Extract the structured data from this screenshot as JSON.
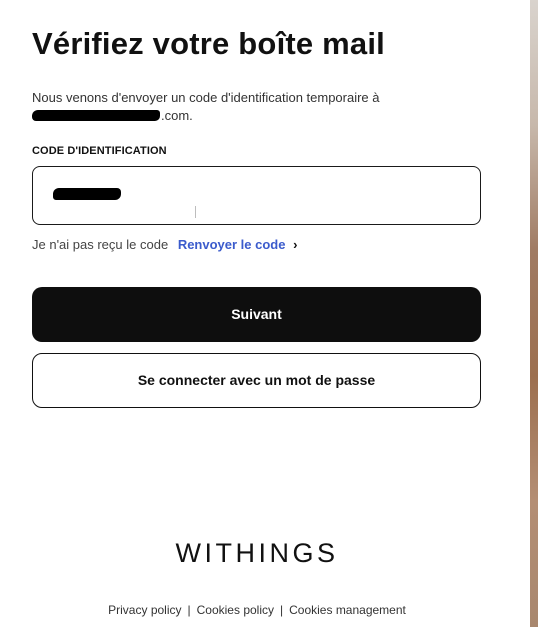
{
  "title": "Vérifiez votre boîte mail",
  "intro": {
    "line1": "Nous venons d'envoyer un code d'identification temporaire à",
    "email_suffix": ".com."
  },
  "code_field": {
    "label": "CODE D'IDENTIFICATION"
  },
  "resend": {
    "prompt": "Je n'ai pas reçu le code",
    "link": "Renvoyer le code",
    "chevron": "›"
  },
  "buttons": {
    "primary": "Suivant",
    "secondary": "Se connecter avec un mot de passe"
  },
  "brand": "WITHINGS",
  "footer": {
    "links": [
      "Privacy policy",
      "Cookies policy",
      "Cookies management"
    ],
    "separator": "|"
  }
}
